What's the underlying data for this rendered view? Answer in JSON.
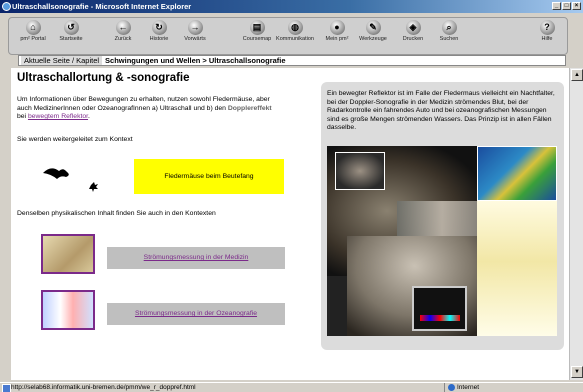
{
  "window": {
    "title": "Ultraschallsonografie - Microsoft Internet Explorer"
  },
  "nav": {
    "buttons": [
      {
        "label": "pm² Portal",
        "icon": "home-icon",
        "glyph": "⌂"
      },
      {
        "label": "Startseite",
        "icon": "start-icon",
        "glyph": "↺"
      },
      {
        "label": "Zurück",
        "icon": "back-icon",
        "glyph": "←"
      },
      {
        "label": "Historie",
        "icon": "history-icon",
        "glyph": "↻"
      },
      {
        "label": "Vorwärts",
        "icon": "forward-icon",
        "glyph": "→"
      },
      {
        "label": "Coursemap",
        "icon": "coursemap-icon",
        "glyph": "▤"
      },
      {
        "label": "Kommunikation",
        "icon": "chat-icon",
        "glyph": "◍"
      },
      {
        "label": "Mein pm²",
        "icon": "mypm-icon",
        "glyph": "●"
      },
      {
        "label": "Werkzeuge",
        "icon": "tools-icon",
        "glyph": "✎"
      },
      {
        "label": "Drucken",
        "icon": "print-icon",
        "glyph": "◈"
      },
      {
        "label": "Suchen",
        "icon": "search-icon",
        "glyph": "⌕"
      },
      {
        "label": "Hilfe",
        "icon": "help-icon",
        "glyph": "?"
      }
    ]
  },
  "breadcrumb": {
    "label": "Aktuelle Seite / Kapitel",
    "path": "Schwingungen und Wellen > Ultraschallsonografie"
  },
  "main": {
    "title": "Ultraschallortung & -sonografie",
    "intro_1": "Um Informationen über Bewegungen zu erhalten, nutzen sowohl Fledermäuse, aber auch MedizinerInnen oder OzeanografInnen a) Ultraschall und b) den ",
    "intro_highlight": "Dopplereffekt",
    "intro_2": " bei ",
    "intro_link": "bewegtem Reflektor",
    "intro_3": ".",
    "redirect_text": "Sie werden weitergeleitet zum Kontext",
    "context_box": "Fledermäuse beim Beutefang",
    "also_text": "Denselben physikalischen Inhalt finden Sie auch in den Kontexten",
    "link_medicine": "Strömungsmessung in der Medizin",
    "link_ocean": "Strömungsmessung in der Ozeanografie",
    "side_text": "Ein bewegter Reflektor ist im Falle der Fledermaus vielleicht ein Nachtfalter, bei der Doppler-Sonografie in der Medizin strömendes Blut, bei der Radarkontrolle ein fahrendes Auto und bei ozeanografischen Messungen sind es große Mengen strömenden Wassers. Das Prinzip ist in allen Fällen dasselbe."
  },
  "status": {
    "url": "http://selab68.informatik.uni-bremen.de/pmm/we_r_doppref.html",
    "zone": "Internet"
  },
  "colors": {
    "link": "#7b2a8a",
    "context_box": "#ffff00",
    "titlebar": "#0a246a"
  }
}
